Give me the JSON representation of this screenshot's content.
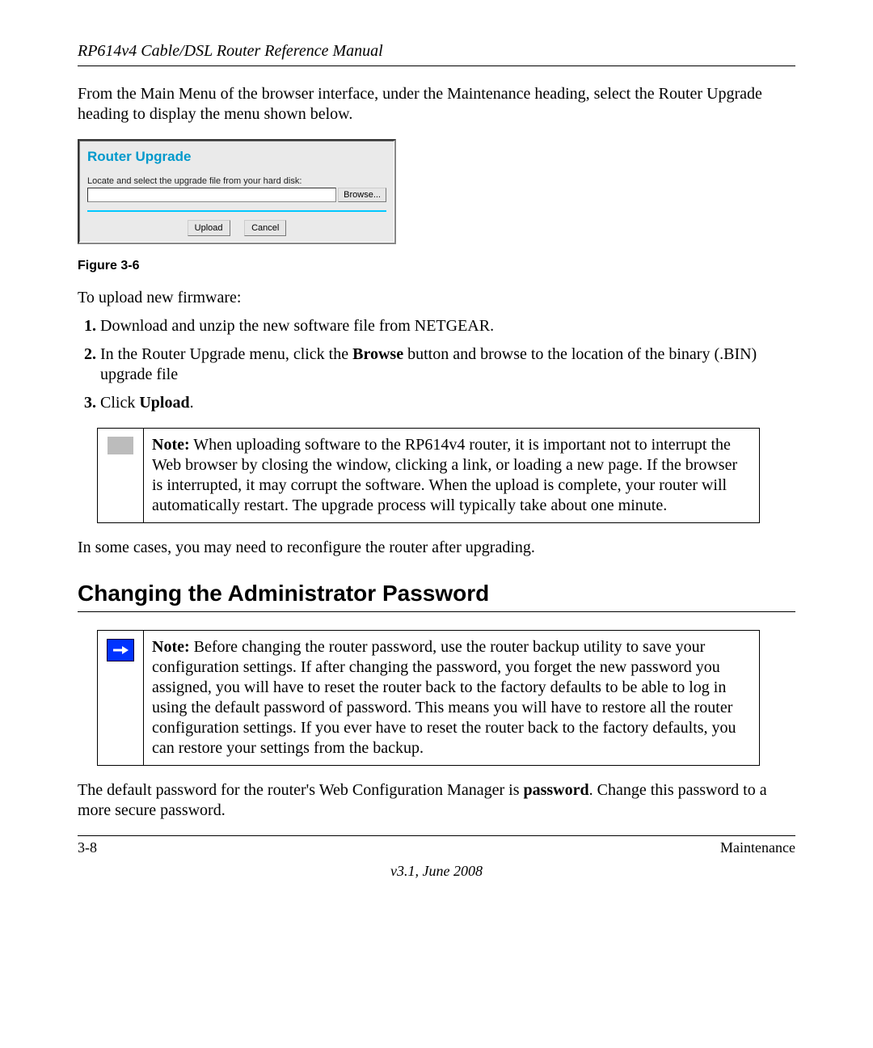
{
  "header": {
    "running_head": "RP614v4 Cable/DSL Router Reference Manual"
  },
  "intro_para": "From the Main Menu of the browser interface, under the Maintenance heading, select the Router Upgrade heading to display the menu shown below.",
  "router_widget": {
    "title": "Router Upgrade",
    "instruction": "Locate and select the upgrade file from your hard disk:",
    "browse_label": "Browse...",
    "upload_label": "Upload",
    "cancel_label": "Cancel"
  },
  "figure_caption": "Figure 3-6",
  "upload_intro": "To upload new firmware:",
  "steps": {
    "s1": "Download and unzip the new software file from NETGEAR.",
    "s2_a": "In the Router Upgrade menu, click the ",
    "s2_b": "Browse",
    "s2_c": " button and browse to the location of the binary (.BIN) upgrade file",
    "s3_a": "Click ",
    "s3_b": "Upload",
    "s3_c": "."
  },
  "note1": {
    "label": "Note:",
    "body": " When uploading software to the RP614v4 router, it is important not to interrupt the Web browser by closing the window, clicking a link, or loading a new page. If the browser is interrupted, it may corrupt the software. When the upload is complete, your router will automatically restart. The upgrade process will typically take about one minute."
  },
  "post_note1": "In some cases, you may need to reconfigure the router after upgrading.",
  "section_heading": "Changing the Administrator Password",
  "note2": {
    "label": "Note:",
    "body": " Before changing the router password, use the router backup utility to save your configuration settings. If after changing the password, you forget the new password you assigned, you will have to reset the router back to the factory defaults to be able to log in using the default password of password. This means you will have to restore all the router configuration settings. If you ever have to reset the router back to the factory defaults, you can restore your settings from the backup."
  },
  "post_note2_a": "The default password for the router's Web Configuration Manager is ",
  "post_note2_b": "password",
  "post_note2_c": ". Change this password to a more secure password.",
  "footer": {
    "page": "3-8",
    "section": "Maintenance",
    "version": "v3.1, June 2008"
  }
}
